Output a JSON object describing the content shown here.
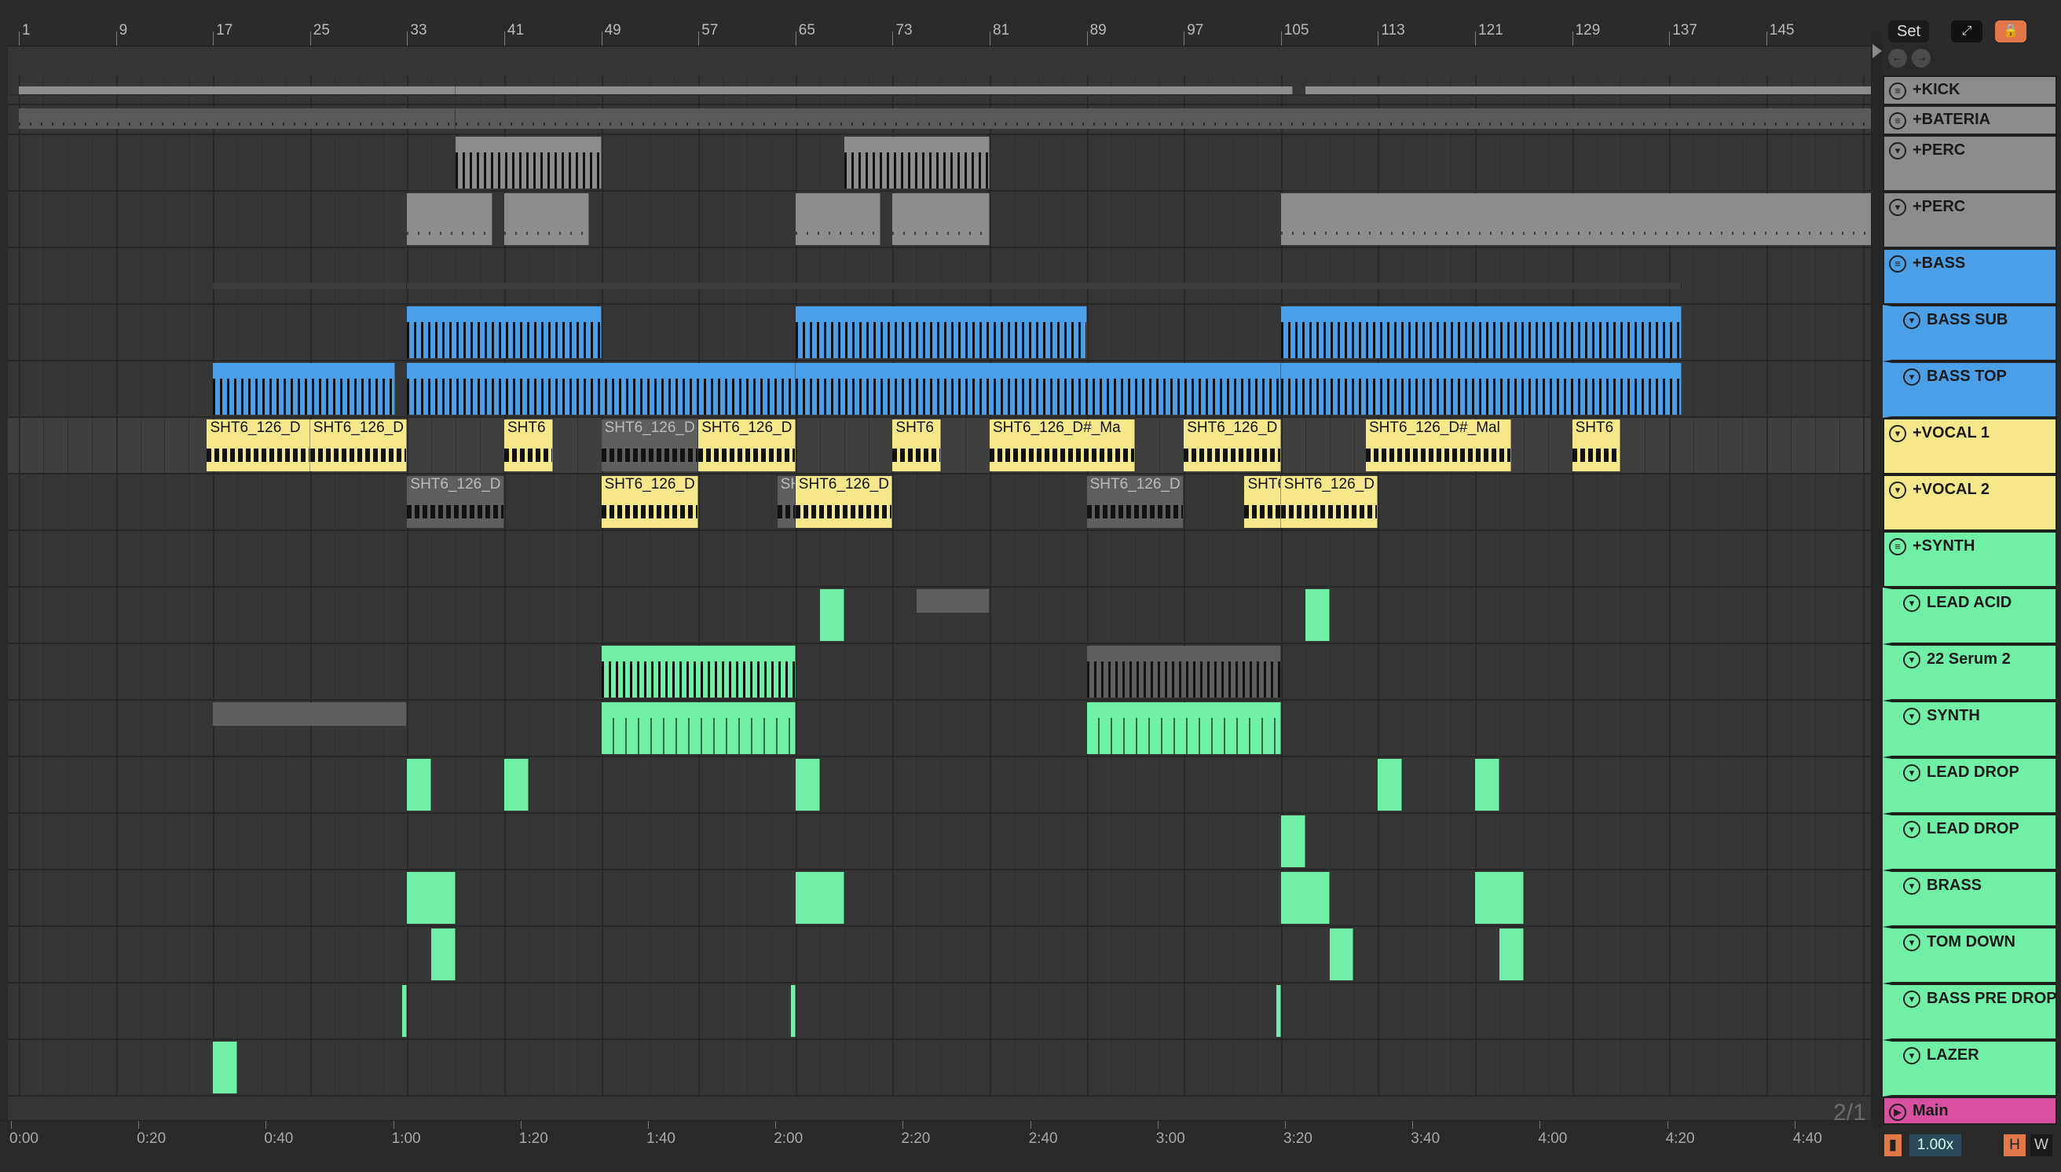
{
  "ruler": {
    "bar_labels": [
      "1",
      "9",
      "17",
      "25",
      "33",
      "41",
      "49",
      "57",
      "65",
      "73",
      "81",
      "89",
      "97",
      "105",
      "113",
      "121",
      "129",
      "137",
      "145"
    ]
  },
  "timeline": {
    "labels": [
      "0:00",
      "0:20",
      "0:40",
      "1:00",
      "1:20",
      "1:40",
      "2:00",
      "2:20",
      "2:40",
      "3:00",
      "3:20",
      "3:40",
      "4:00",
      "4:20",
      "4:40"
    ]
  },
  "top_controls": {
    "set_label": "Set",
    "expand_icon": "expand-icon",
    "lock_icon": "lock-icon"
  },
  "nav": {
    "back_icon": "back-arrow-icon",
    "forward_icon": "forward-arrow-icon"
  },
  "colors": {
    "bass": "#4a9fe6",
    "vocal": "#f5e88a",
    "synth": "#6ff0a6",
    "main": "#d94fa0",
    "gray_clip": "#8c8c8c",
    "background": "#363636"
  },
  "tracks": [
    {
      "name": "+KICK",
      "icon": "group-list-icon",
      "color": "#8c8c8c"
    },
    {
      "name": "+BATERIA",
      "icon": "group-list-icon",
      "color": "#8c8c8c"
    },
    {
      "name": "+PERC",
      "icon": "fold-icon",
      "color": "#8c8c8c"
    },
    {
      "name": "+PERC",
      "icon": "fold-icon",
      "color": "#8c8c8c"
    },
    {
      "name": "+BASS",
      "icon": "group-list-icon",
      "color": "#4a9fe6"
    },
    {
      "name": "BASS SUB",
      "icon": "fold-icon",
      "color": "#4a9fe6"
    },
    {
      "name": "BASS TOP",
      "icon": "fold-icon",
      "color": "#4a9fe6"
    },
    {
      "name": "+VOCAL 1",
      "icon": "fold-icon",
      "color": "#f5e88a"
    },
    {
      "name": "+VOCAL 2",
      "icon": "fold-icon",
      "color": "#f5e88a"
    },
    {
      "name": "+SYNTH",
      "icon": "group-list-icon",
      "color": "#6ff0a6"
    },
    {
      "name": "LEAD ACID",
      "icon": "fold-icon",
      "color": "#6ff0a6"
    },
    {
      "name": "22 Serum 2",
      "icon": "fold-icon",
      "color": "#6ff0a6"
    },
    {
      "name": "SYNTH",
      "icon": "fold-icon",
      "color": "#6ff0a6"
    },
    {
      "name": "LEAD DROP",
      "icon": "fold-icon",
      "color": "#6ff0a6"
    },
    {
      "name": "LEAD DROP",
      "icon": "fold-icon",
      "color": "#6ff0a6"
    },
    {
      "name": "BRASS",
      "icon": "fold-icon",
      "color": "#6ff0a6"
    },
    {
      "name": "TOM DOWN",
      "icon": "fold-icon",
      "color": "#6ff0a6"
    },
    {
      "name": "BASS PRE DROP",
      "icon": "fold-icon",
      "color": "#6ff0a6"
    },
    {
      "name": "LAZER",
      "icon": "fold-icon",
      "color": "#6ff0a6"
    },
    {
      "name": "Main",
      "icon": "play-icon",
      "color": "#d94fa0"
    }
  ],
  "clip_names": {
    "vocal_1": [
      "SHT6_126_D",
      "SHT6_126_D",
      "SHT6",
      "SHT6_126_D",
      "SHT6_126_D",
      "SHT6",
      "SHT6_126_D#_Ma",
      "SHT6_126_D",
      "SHT6_126_D#_Mal",
      "SHT6"
    ],
    "vocal_2": [
      "SHT6_126_D",
      "SHT6_126_D",
      "SH",
      "SHT6_126_D",
      "SHT6_126_D",
      "SHT6",
      "SHT6_126_D"
    ]
  },
  "status": {
    "page_indicator": "2/1",
    "tempo_factor": "1.00x",
    "h_label": "H",
    "w_label": "W"
  }
}
